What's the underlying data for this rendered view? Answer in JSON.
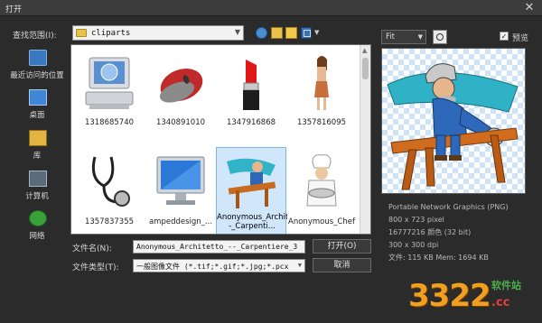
{
  "window": {
    "title": "打开",
    "close_glyph": "✕"
  },
  "lookin": {
    "label": "查找范围(I):",
    "value": "cliparts"
  },
  "places": [
    {
      "label": "最近访问的位置",
      "icon": "recent-places-icon"
    },
    {
      "label": "桌面",
      "icon": "desktop-icon"
    },
    {
      "label": "库",
      "icon": "library-icon"
    },
    {
      "label": "计算机",
      "icon": "computer-icon"
    },
    {
      "label": "网络",
      "icon": "network-icon"
    }
  ],
  "files": [
    {
      "name": "1318685740",
      "icon": "computer-clipart-thumbnail"
    },
    {
      "name": "1340891010",
      "icon": "mouse-clipart-thumbnail"
    },
    {
      "name": "1347916868",
      "icon": "lipstick-clipart-thumbnail"
    },
    {
      "name": "1357816095",
      "icon": "woman-clipart-thumbnail"
    },
    {
      "name": "1357837355",
      "icon": "stethoscope-clipart-thumbnail"
    },
    {
      "name": "ampeddesign_...",
      "icon": "monitor-clipart-thumbnail"
    },
    {
      "name": "Anonymous_Architetto_--_Carpenti...",
      "icon": "carpenter-clipart-thumbnail",
      "selected": true
    },
    {
      "name": "Anonymous_Chef",
      "icon": "chef-clipart-thumbnail"
    }
  ],
  "filename": {
    "label": "文件名(N):",
    "value": "Anonymous_Architetto_--_Carpentiere_3"
  },
  "filetype": {
    "label": "文件类型(T):",
    "value": "一般图像文件 (*.tif;*.gif;*.jpg;*.pcx"
  },
  "buttons": {
    "open": "打开(O)",
    "cancel": "取消"
  },
  "preview": {
    "fit": "Fit",
    "checkbox_checked": true,
    "checkbox_mark": "✓",
    "label": "预览",
    "info": [
      "Portable Network Graphics (PNG)",
      "800 x 723 pixel",
      "16777216 颜色 (32 bit)",
      "300 x 300 dpi",
      "文件: 115 KB   Mem: 1694 KB"
    ]
  },
  "watermark": {
    "digits": "3322",
    "site": "软件站",
    "domain": ".cc"
  }
}
